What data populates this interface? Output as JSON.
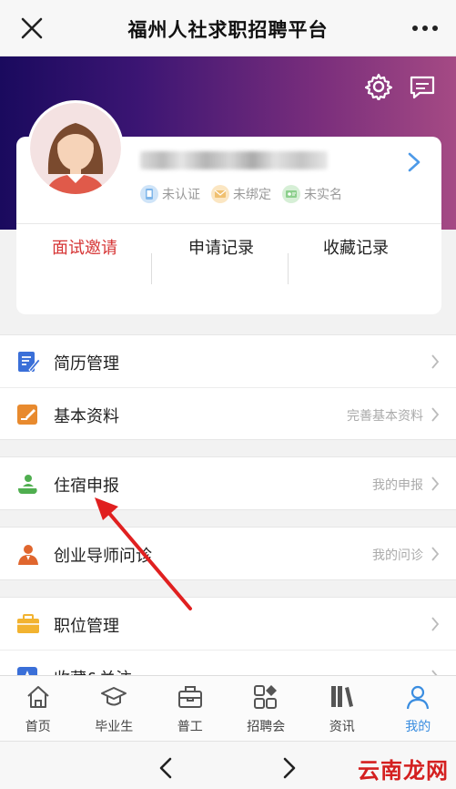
{
  "titlebar": {
    "title": "福州人社求职招聘平台"
  },
  "badges": [
    {
      "label": "未认证",
      "color": "#7fb6ea"
    },
    {
      "label": "未绑定",
      "color": "#f0c070"
    },
    {
      "label": "未实名",
      "color": "#8ccf8c"
    }
  ],
  "stats": [
    {
      "label": "面试邀请",
      "active": true
    },
    {
      "label": "申请记录",
      "active": false
    },
    {
      "label": "收藏记录",
      "active": false
    }
  ],
  "menu": [
    {
      "label": "简历管理",
      "hint": "",
      "icon": "resume-icon"
    },
    {
      "label": "基本资料",
      "hint": "完善基本资料",
      "icon": "edit-icon"
    },
    {
      "label": "住宿申报",
      "hint": "我的申报",
      "icon": "accommodation-icon"
    },
    {
      "label": "创业导师问诊",
      "hint": "我的问诊",
      "icon": "mentor-icon"
    },
    {
      "label": "职位管理",
      "hint": "",
      "icon": "briefcase-icon"
    },
    {
      "label": "收藏&关注",
      "hint": "",
      "icon": "star-icon"
    }
  ],
  "tabs": [
    {
      "label": "首页",
      "icon": "home-icon"
    },
    {
      "label": "毕业生",
      "icon": "graduate-cap-icon"
    },
    {
      "label": "普工",
      "icon": "toolbox-icon"
    },
    {
      "label": "招聘会",
      "icon": "grid-icon"
    },
    {
      "label": "资讯",
      "icon": "books-icon"
    },
    {
      "label": "我的",
      "icon": "person-icon",
      "active": true
    }
  ],
  "watermark": "云南龙网",
  "colors": {
    "accent": "#3a8de0",
    "active_stat": "#d63535",
    "header_start": "#1a0a5e",
    "header_end": "#a54a84"
  }
}
